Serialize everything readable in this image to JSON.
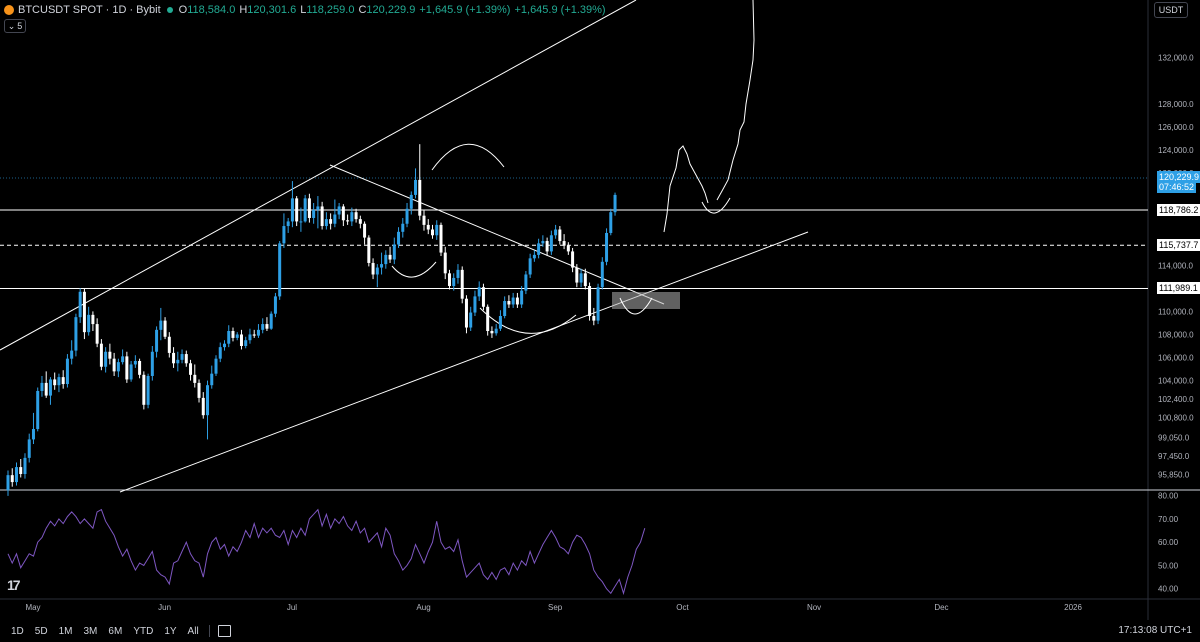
{
  "header": {
    "symbol": "BTCUSDT SPOT · 1D · Bybit",
    "open_label": "O",
    "open": "118,584.0",
    "high_label": "H",
    "high": "120,301.6",
    "low_label": "L",
    "low": "118,259.0",
    "close_label": "C",
    "close": "120,229.9",
    "change": "+1,645.9 (+1.39%)",
    "change2": "+1,645.9 (+1.39%)",
    "market_status_color": "#22ab94"
  },
  "indicator_toggle": {
    "count": "5"
  },
  "currency": "USDT",
  "colors": {
    "up": "#2ea0e6",
    "down": "#ffffff",
    "rsi": "#7e57c2",
    "accent": "#2ea0e6"
  },
  "chart_data": {
    "type": "candlestick",
    "price_axis_ticks": [
      "132,000.0",
      "128,000.0",
      "126,000.0",
      "124,000.0",
      "122,000.0",
      "116,000.0",
      "114,000.0",
      "110,000.0",
      "108,000.0",
      "106,000.0",
      "104,000.0",
      "102,400.0",
      "100,800.0",
      "99,050.0",
      "97,450.0",
      "95,850.0"
    ],
    "price_axis_values": [
      132000,
      128000,
      126000,
      124000,
      122000,
      116000,
      114000,
      110000,
      108000,
      106000,
      104000,
      102400,
      100800,
      99050,
      97450,
      95850
    ],
    "ylim": [
      94600,
      137000
    ],
    "rsi_axis_ticks": [
      "80.00",
      "70.00",
      "60.00",
      "50.00",
      "40.00"
    ],
    "rsi_axis_values": [
      80,
      70,
      60,
      50,
      40
    ],
    "rsi_ylim": [
      36,
      82
    ],
    "time_axis_labels": [
      "May",
      "Jun",
      "Jul",
      "Aug",
      "Sep",
      "Oct",
      "Nov",
      "Dec",
      "2026"
    ],
    "time_axis_days": [
      0,
      31,
      61,
      92,
      123,
      153,
      184,
      214,
      245
    ],
    "current_price": {
      "label": "120,229.9",
      "countdown": "07:46:52",
      "value": 120229.9
    },
    "levels": [
      {
        "label": "118,786.2",
        "value": 118786.2,
        "style": "solid"
      },
      {
        "label": "115,737.7",
        "value": 115737.7,
        "style": "dashed"
      },
      {
        "label": "111,989.1",
        "value": 111989.1,
        "style": "solid"
      }
    ],
    "candles": [
      [
        94500,
        95800,
        94000,
        96200
      ],
      [
        95800,
        95200,
        94800,
        96400
      ],
      [
        95200,
        96500,
        94900,
        96900
      ],
      [
        96500,
        95900,
        95600,
        97200
      ],
      [
        95900,
        97300,
        95500,
        97700
      ],
      [
        97300,
        98900,
        96900,
        99400
      ],
      [
        98900,
        99800,
        98500,
        101200
      ],
      [
        99800,
        103100,
        99600,
        103400
      ],
      [
        103100,
        103800,
        102600,
        104400
      ],
      [
        103800,
        102700,
        102500,
        104800
      ],
      [
        102700,
        104100,
        101900,
        104300
      ],
      [
        104100,
        103600,
        103200,
        104700
      ],
      [
        103600,
        104300,
        103000,
        104600
      ],
      [
        104300,
        103700,
        103300,
        104900
      ],
      [
        103700,
        105900,
        103400,
        106300
      ],
      [
        105900,
        106600,
        105400,
        107500
      ],
      [
        106600,
        109500,
        106100,
        109800
      ],
      [
        109500,
        111700,
        109000,
        112000
      ],
      [
        111700,
        108200,
        107600,
        112000
      ],
      [
        108200,
        109700,
        107900,
        110400
      ],
      [
        109700,
        108900,
        108300,
        110000
      ],
      [
        108900,
        107200,
        106900,
        109400
      ],
      [
        107200,
        105200,
        104900,
        107600
      ],
      [
        105200,
        106500,
        104700,
        106900
      ],
      [
        106500,
        105900,
        105400,
        107200
      ],
      [
        105900,
        104800,
        104400,
        106400
      ],
      [
        104800,
        105600,
        104300,
        105900
      ],
      [
        105600,
        106100,
        105400,
        106700
      ],
      [
        106100,
        104100,
        103800,
        106500
      ],
      [
        104100,
        105400,
        103900,
        105700
      ],
      [
        105400,
        105700,
        105100,
        106200
      ],
      [
        105700,
        104500,
        104200,
        105900
      ],
      [
        104500,
        101900,
        101500,
        104800
      ],
      [
        101900,
        104400,
        101600,
        104600
      ],
      [
        104400,
        106500,
        104000,
        107000
      ],
      [
        106500,
        108400,
        106000,
        108700
      ],
      [
        108400,
        109200,
        107500,
        110300
      ],
      [
        109200,
        107800,
        107600,
        109500
      ],
      [
        107800,
        106400,
        106000,
        108200
      ],
      [
        106400,
        105500,
        105100,
        106900
      ],
      [
        105500,
        105800,
        104800,
        106500
      ],
      [
        105800,
        106300,
        105500,
        106700
      ],
      [
        106300,
        105500,
        105200,
        106600
      ],
      [
        105500,
        104500,
        104000,
        105800
      ],
      [
        104500,
        103800,
        103400,
        105400
      ],
      [
        103800,
        102500,
        102100,
        104100
      ],
      [
        102500,
        101000,
        100700,
        103000
      ],
      [
        101000,
        103600,
        98900,
        104000
      ],
      [
        103600,
        104600,
        103300,
        105300
      ],
      [
        104600,
        105900,
        104400,
        106200
      ],
      [
        105900,
        106900,
        105600,
        107300
      ],
      [
        106900,
        107200,
        106600,
        107500
      ],
      [
        107200,
        108300,
        106900,
        108800
      ],
      [
        108300,
        107700,
        107400,
        108600
      ],
      [
        107700,
        108000,
        107500,
        108200
      ],
      [
        108000,
        107000,
        106700,
        108400
      ],
      [
        107000,
        107500,
        106800,
        107800
      ],
      [
        107500,
        108000,
        107200,
        108500
      ],
      [
        108000,
        107900,
        107700,
        108400
      ],
      [
        107900,
        108400,
        107700,
        108900
      ],
      [
        108400,
        108900,
        108100,
        109400
      ],
      [
        108900,
        108500,
        108300,
        109500
      ],
      [
        108500,
        109800,
        108400,
        110000
      ],
      [
        109800,
        111300,
        109500,
        111600
      ],
      [
        111300,
        115900,
        111000,
        116100
      ],
      [
        115900,
        117400,
        115500,
        118500
      ],
      [
        117400,
        117800,
        116800,
        118100
      ],
      [
        117800,
        119800,
        117300,
        121300
      ],
      [
        119800,
        117800,
        117400,
        120000
      ],
      [
        117800,
        117800,
        116900,
        119000
      ],
      [
        117800,
        119800,
        117700,
        120100
      ],
      [
        119800,
        118100,
        117700,
        120200
      ],
      [
        118100,
        118800,
        117600,
        119400
      ],
      [
        118800,
        119100,
        117200,
        120000
      ],
      [
        119100,
        117400,
        117100,
        119500
      ],
      [
        117400,
        118000,
        117100,
        118600
      ],
      [
        118000,
        117600,
        117100,
        118500
      ],
      [
        117600,
        118400,
        117300,
        119700
      ],
      [
        118400,
        119100,
        118000,
        119400
      ],
      [
        119100,
        117900,
        117400,
        119300
      ],
      [
        117900,
        117800,
        117500,
        118400
      ],
      [
        117800,
        118600,
        117400,
        119000
      ],
      [
        118600,
        118000,
        117700,
        118900
      ],
      [
        118000,
        117600,
        117200,
        118300
      ],
      [
        117600,
        116400,
        115800,
        117800
      ],
      [
        116400,
        114200,
        113900,
        116600
      ],
      [
        114200,
        113200,
        112800,
        114600
      ],
      [
        113200,
        113800,
        112100,
        114100
      ],
      [
        113800,
        114100,
        113200,
        115100
      ],
      [
        114100,
        114900,
        113700,
        115300
      ],
      [
        114900,
        114500,
        114200,
        115600
      ],
      [
        114500,
        115800,
        114100,
        116400
      ],
      [
        115800,
        116900,
        115500,
        117300
      ],
      [
        116900,
        117600,
        116400,
        118100
      ],
      [
        117600,
        118900,
        117300,
        119400
      ],
      [
        118900,
        120100,
        118400,
        120400
      ],
      [
        120100,
        121400,
        119800,
        122400
      ],
      [
        121400,
        118300,
        117900,
        124500
      ],
      [
        118300,
        117500,
        117000,
        118800
      ],
      [
        117500,
        117100,
        116700,
        118000
      ],
      [
        117100,
        116600,
        116300,
        117500
      ],
      [
        116600,
        117500,
        116200,
        117900
      ],
      [
        117500,
        115100,
        114800,
        117700
      ],
      [
        115100,
        113300,
        112800,
        115600
      ],
      [
        113300,
        112200,
        111900,
        113600
      ],
      [
        112200,
        112900,
        111800,
        113300
      ],
      [
        112900,
        113600,
        112400,
        114100
      ],
      [
        113600,
        111100,
        110700,
        113900
      ],
      [
        111100,
        108600,
        108100,
        111400
      ],
      [
        108600,
        109900,
        108300,
        110400
      ],
      [
        109900,
        111300,
        109600,
        111800
      ],
      [
        111300,
        112100,
        110900,
        112600
      ],
      [
        112100,
        110400,
        110100,
        112400
      ],
      [
        110400,
        108300,
        107900,
        110600
      ],
      [
        108300,
        108100,
        107700,
        108700
      ],
      [
        108100,
        108500,
        107900,
        108900
      ],
      [
        108500,
        109600,
        108300,
        110100
      ],
      [
        109600,
        110900,
        109400,
        111300
      ],
      [
        110900,
        110600,
        110300,
        111400
      ],
      [
        110600,
        111200,
        110300,
        111600
      ],
      [
        111200,
        110600,
        110300,
        111600
      ],
      [
        110600,
        111800,
        110300,
        112200
      ],
      [
        111800,
        113200,
        111500,
        113500
      ],
      [
        113200,
        114600,
        112900,
        115000
      ],
      [
        114600,
        114900,
        114300,
        115300
      ],
      [
        114900,
        115900,
        114600,
        116300
      ],
      [
        115900,
        116100,
        115600,
        116600
      ],
      [
        116100,
        115200,
        114800,
        116400
      ],
      [
        115200,
        116600,
        114900,
        117000
      ],
      [
        116600,
        117100,
        116300,
        117500
      ],
      [
        117100,
        116100,
        115800,
        117400
      ],
      [
        116100,
        115700,
        115400,
        116700
      ],
      [
        115700,
        115200,
        114900,
        116000
      ],
      [
        115200,
        113800,
        113400,
        115500
      ],
      [
        113800,
        112500,
        112100,
        114100
      ],
      [
        112500,
        113300,
        112100,
        113700
      ],
      [
        113300,
        112200,
        111900,
        113700
      ],
      [
        112200,
        109600,
        109200,
        112500
      ],
      [
        109600,
        109200,
        108800,
        110300
      ],
      [
        109200,
        112100,
        108900,
        112400
      ],
      [
        112100,
        114300,
        111900,
        114700
      ],
      [
        114300,
        116800,
        114000,
        117200
      ],
      [
        116800,
        118600,
        116600,
        118900
      ],
      [
        118600,
        120100,
        118300,
        120300
      ]
    ],
    "rsi_values": [
      55,
      51,
      55,
      49,
      52,
      55,
      54,
      60,
      62,
      66,
      69,
      67,
      70,
      68,
      71,
      73,
      71,
      68,
      70,
      68,
      66,
      73,
      74,
      69,
      66,
      63,
      58,
      54,
      57,
      52,
      48,
      51,
      50,
      53,
      56,
      48,
      46,
      45,
      42,
      51,
      52,
      56,
      60,
      55,
      52,
      51,
      45,
      55,
      60,
      62,
      57,
      59,
      54,
      58,
      56,
      60,
      65,
      62,
      68,
      62,
      66,
      64,
      66,
      63,
      62,
      65,
      59,
      65,
      62,
      66,
      63,
      70,
      72,
      74,
      67,
      72,
      66,
      70,
      68,
      71,
      67,
      65,
      69,
      64,
      66,
      60,
      62,
      64,
      58,
      66,
      63,
      55,
      52,
      48,
      50,
      53,
      59,
      55,
      51,
      56,
      60,
      69,
      60,
      57,
      58,
      56,
      61,
      52,
      45,
      47,
      49,
      51,
      46,
      44,
      47,
      44,
      48,
      49,
      46,
      51,
      48,
      52,
      50,
      56,
      51,
      55,
      59,
      62,
      65,
      62,
      58,
      57,
      55,
      60,
      63,
      62,
      59,
      55,
      48,
      45,
      43,
      40,
      38,
      41,
      44,
      38,
      45,
      50,
      57,
      60,
      66
    ]
  }
}
